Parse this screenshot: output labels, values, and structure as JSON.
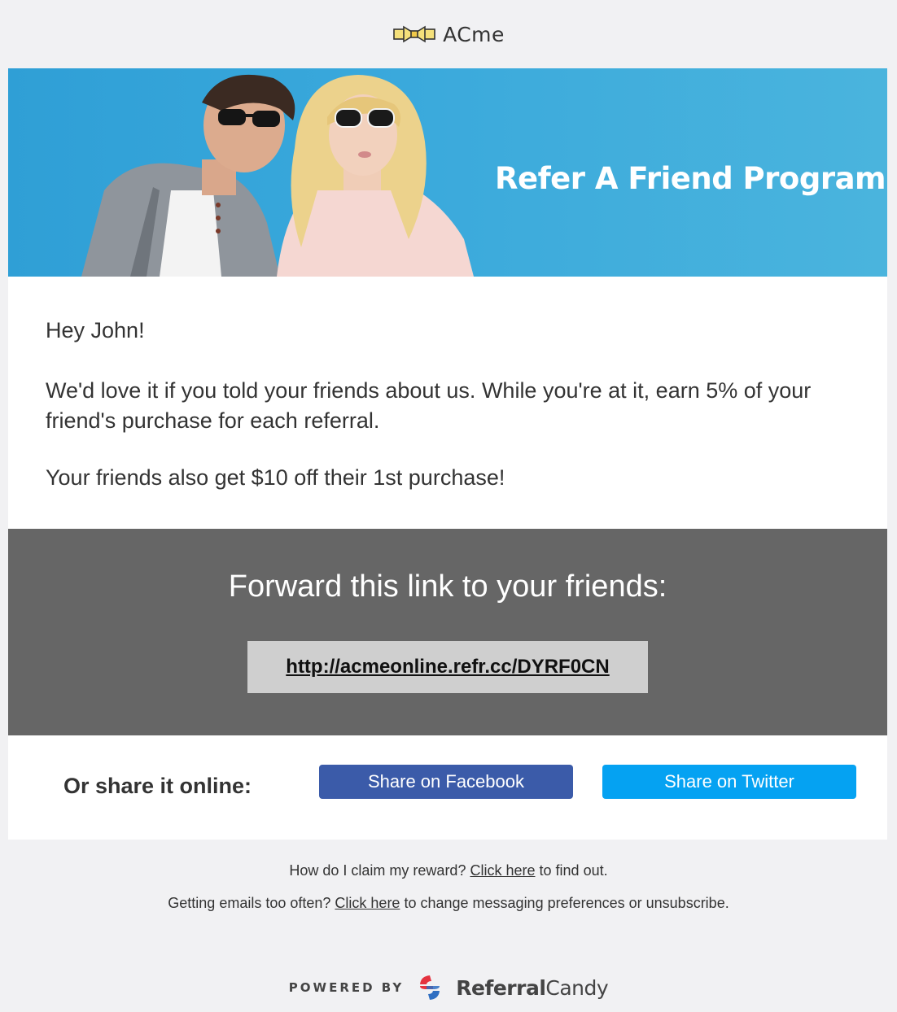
{
  "header": {
    "logo_text": "ACme",
    "logo_icon": "acme-bowtie-logo"
  },
  "banner": {
    "title": "Refer A Friend Program",
    "background_color": "#49b2dc"
  },
  "message": {
    "greeting": "Hey John!",
    "pitch": "We'd love it if you told your friends about us. While you're at it, earn 5% of your friend's purchase for each referral.",
    "bonus": "Your friends also get $10 off their 1st purchase!"
  },
  "forward": {
    "title": "Forward this link to your friends:",
    "link": "http://acmeonline.refr.cc/DYRF0CN"
  },
  "share": {
    "label": "Or share it online:",
    "facebook_label": "Share on Facebook",
    "twitter_label": "Share on Twitter",
    "facebook_color": "#3b5ba9",
    "twitter_color": "#05a2f2"
  },
  "footer": {
    "claim_prefix": "How do I claim my reward?",
    "claim_link": "Click here",
    "claim_suffix": "to find out.",
    "prefs_prefix": "Getting emails too often?",
    "prefs_link": "Click here",
    "prefs_suffix": "to change messaging preferences or unsubscribe."
  },
  "powered": {
    "label": "POWERED BY",
    "brand_bold": "Referral",
    "brand_regular": "Candy",
    "brand_icon": "referralcandy-logo"
  }
}
